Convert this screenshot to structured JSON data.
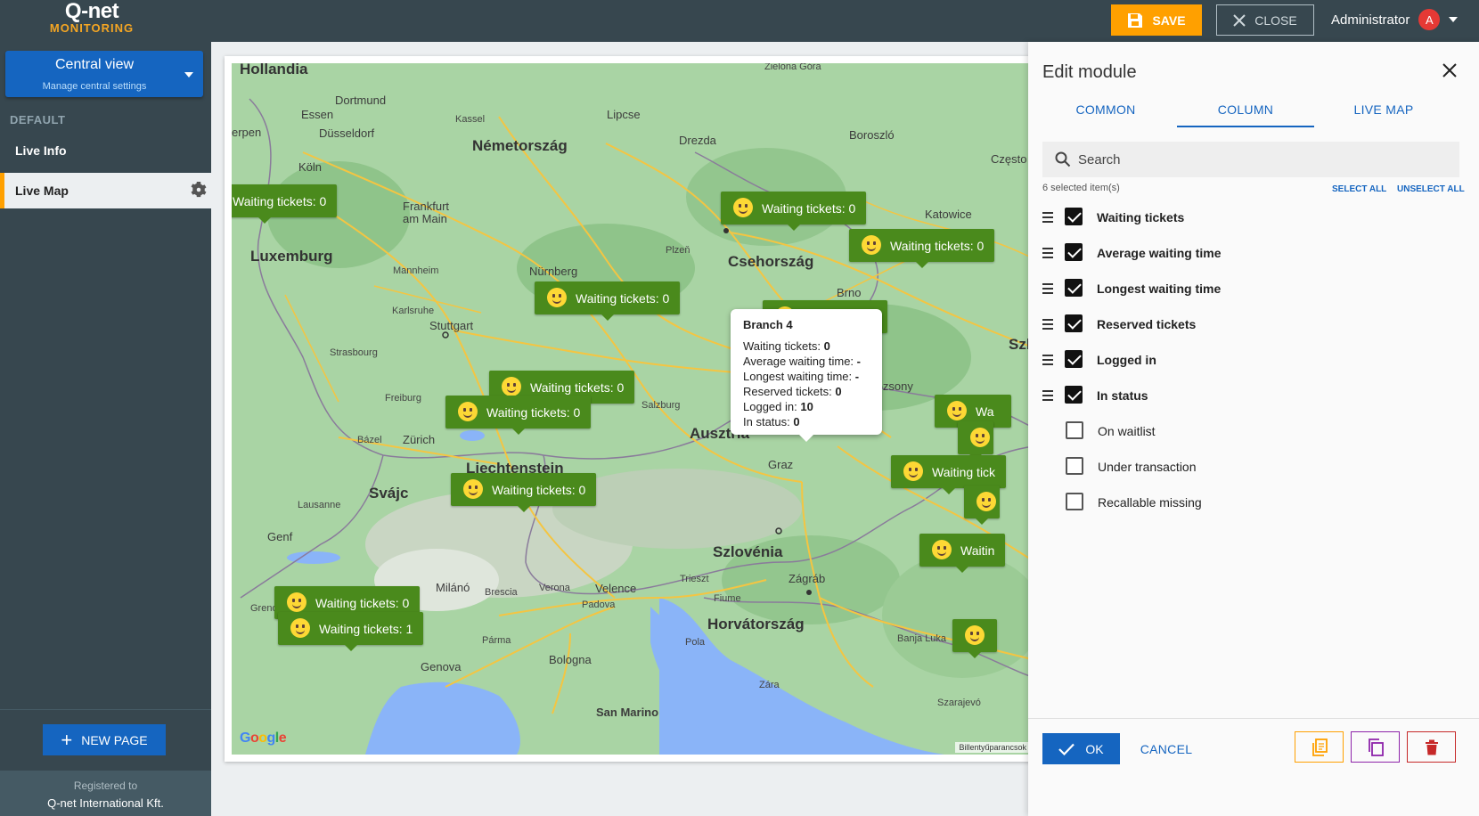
{
  "header": {
    "logo_brand": "Q-net",
    "logo_sub": "MONITORING",
    "save_label": "SAVE",
    "close_label": "CLOSE",
    "user_name": "Administrator",
    "user_initial": "A"
  },
  "sidebar": {
    "central_title": "Central view",
    "central_subtitle": "Manage central settings",
    "section_label": "DEFAULT",
    "items": [
      {
        "label": "Live Info"
      },
      {
        "label": "Live Map"
      }
    ],
    "new_page_label": "NEW PAGE",
    "footer_line1": "Registered to",
    "footer_line2": "Q-net International Kft."
  },
  "map": {
    "labels": {
      "hollandia": "Hollandia",
      "nemetorszag": "Németország",
      "csehorszag": "Csehország",
      "luxemburg": "Luxemburg",
      "svajc": "Svájc",
      "liechtenstein": "Liechtenstein",
      "ausztria": "Ausztria",
      "szlovenia": "Szlovénia",
      "horvatorszag": "Horvátország",
      "szlo": "Szlo",
      "san_marino": "San Marino",
      "dortmund": "Dortmund",
      "essen": "Essen",
      "dusseldorf": "Düsseldorf",
      "koln": "Köln",
      "kassel": "Kassel",
      "lipcse": "Lipcse",
      "drezda": "Drezda",
      "boroszlo": "Boroszló",
      "czestoc": "Często",
      "zielona_gora": "Zielona Góra",
      "frankfurt": "Frankfurt am Main",
      "katowice": "Katowice",
      "mannheim": "Mannheim",
      "nurnberg": "Nürnberg",
      "plzen": "Plzeň",
      "brno": "Brno",
      "karlsruhe": "Karlsruhe",
      "stuttgart": "Stuttgart",
      "strasbourg": "Strasbourg",
      "pozsony": "Pozsony",
      "freiburg": "Freiburg",
      "salzburg": "Salzburg",
      "bazel": "Bázel",
      "zurich": "Zürich",
      "graz": "Graz",
      "lausanne": "Lausanne",
      "genf": "Genf",
      "milano": "Milánó",
      "brescia": "Brescia",
      "verona": "Verona",
      "velence": "Velence",
      "padova": "Padova",
      "trieszt": "Trieszt",
      "fiume": "Fiume",
      "zagrab": "Zágráb",
      "banja_luka": "Banja Luka",
      "parma": "Pármа",
      "bologna": "Bologna",
      "pola": "Pola",
      "zara": "Zára",
      "genova": "Genova",
      "grenoble": "Greno",
      "erpen": "erpen",
      "szarajevo": "Szarajevó"
    },
    "marker_texts": {
      "waiting_0": "Waiting tickets: 0",
      "waiting_1": "Waiting tickets: 1",
      "waiting_short_0": "Waiting tickets: 0",
      "wa": "Wa",
      "waiting_tick": "Waiting tick",
      "waitin": "Waitin",
      "right_0": "0"
    },
    "popup": {
      "title": "Branch 4",
      "rows": [
        {
          "label": "Waiting tickets:",
          "value": "0"
        },
        {
          "label": "Average waiting time:",
          "value": "-"
        },
        {
          "label": "Longest waiting time:",
          "value": "-"
        },
        {
          "label": "Reserved tickets:",
          "value": "0"
        },
        {
          "label": "Logged in:",
          "value": "10"
        },
        {
          "label": "In status:",
          "value": "0"
        }
      ]
    },
    "google_logo": "Google",
    "keyboard_shortcuts": "Billentyűparancsok"
  },
  "edit_module": {
    "title": "Edit module",
    "tabs": [
      {
        "label": "COMMON",
        "active": false
      },
      {
        "label": "COLUMN",
        "active": true
      },
      {
        "label": "LIVE MAP",
        "active": false
      }
    ],
    "search_placeholder": "Search",
    "selected_count": "6 selected item(s)",
    "select_all": "SELECT ALL",
    "unselect_all": "UNSELECT ALL",
    "items": [
      {
        "label": "Waiting tickets",
        "checked": true
      },
      {
        "label": "Average waiting time",
        "checked": true
      },
      {
        "label": "Longest waiting time",
        "checked": true
      },
      {
        "label": "Reserved tickets",
        "checked": true
      },
      {
        "label": "Logged in",
        "checked": true
      },
      {
        "label": "In status",
        "checked": true
      },
      {
        "label": "On waitlist",
        "checked": false
      },
      {
        "label": "Under transaction",
        "checked": false
      },
      {
        "label": "Recallable missing",
        "checked": false
      }
    ],
    "ok_label": "OK",
    "cancel_label": "CANCEL"
  },
  "colors": {
    "topbar": "#37474f",
    "accent": "#ffa000",
    "primary": "#1565c0",
    "marker_green": "#4a8a1c",
    "delete_red": "#c62828",
    "copy_purple": "#8e24aa"
  }
}
